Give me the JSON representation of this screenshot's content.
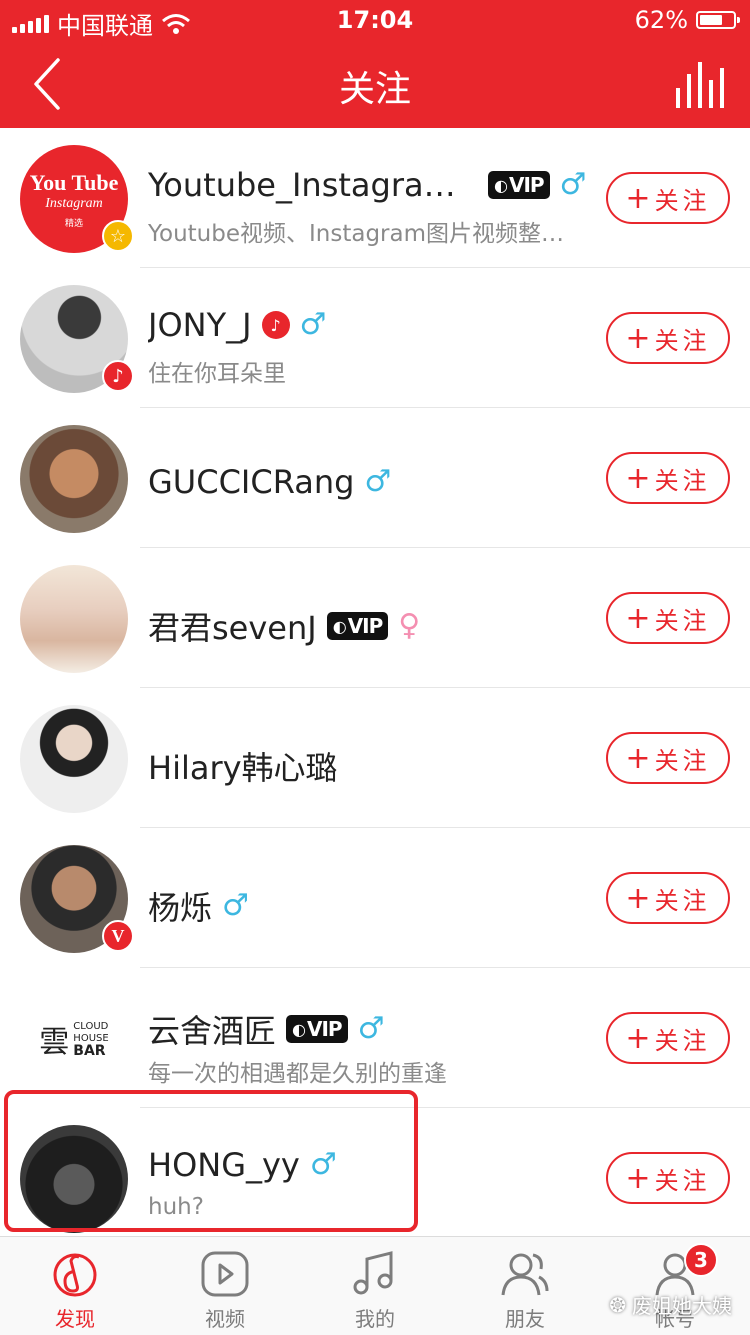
{
  "status_bar": {
    "carrier": "中国联通",
    "time": "17:04",
    "battery": "62%"
  },
  "nav": {
    "title": "关注"
  },
  "follow_label": "关注",
  "users": [
    {
      "name": "Youtube_Instagram…",
      "vip": "VIP",
      "gender": "♂",
      "desc": "Youtube视频、Instagram图片视频整…",
      "logo_top": "You Tube",
      "logo_mid": "Instagram",
      "logo_small": "精选"
    },
    {
      "name": "JONY_J",
      "gender": "♂",
      "desc": "住在你耳朵里"
    },
    {
      "name": "GUCCICRang",
      "gender": "♂"
    },
    {
      "name": "君君sevenJ",
      "vip": "VIP",
      "gender": "♀"
    },
    {
      "name": "Hilary韩心璐"
    },
    {
      "name": "杨烁",
      "gender": "♂",
      "badge": "V"
    },
    {
      "name": "云舍酒匠",
      "vip": "VIP",
      "gender": "♂",
      "desc": "每一次的相遇都是久别的重逢",
      "logo_a": "CLOUD",
      "logo_b": "HOUSE",
      "logo_c": "BAR"
    },
    {
      "name": "HONG_yy",
      "gender": "♂",
      "desc": "huh?"
    }
  ],
  "tabs": [
    {
      "label": "发现"
    },
    {
      "label": "视频"
    },
    {
      "label": "我的"
    },
    {
      "label": "朋友"
    },
    {
      "label": "帐号",
      "badge": "3"
    }
  ],
  "watermark": "废姐她大姨",
  "colors": {
    "brand_red": "#e8262c",
    "male_blue": "#3db7e0",
    "female_pink": "#f48fb1"
  }
}
